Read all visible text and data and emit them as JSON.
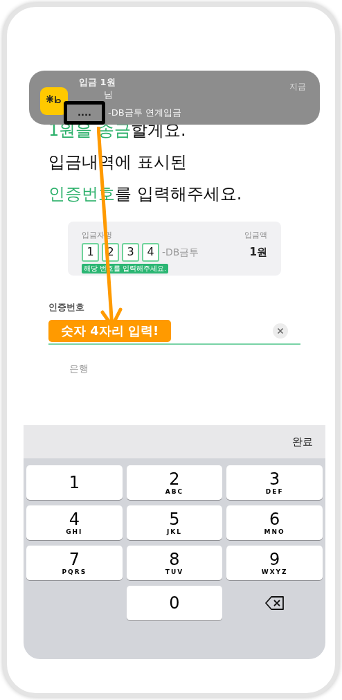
{
  "notification": {
    "title": "입금 1원",
    "sender": "님",
    "masked": "....",
    "detail": "-DB금투 연계입금",
    "time": "지금"
  },
  "heading": [
    [
      {
        "text": "1원을 송금",
        "highlight": true
      },
      {
        "text": "할게요.",
        "highlight": false
      }
    ],
    [
      {
        "text": "입금내역에 표시된",
        "highlight": false
      }
    ],
    [
      {
        "text": "인증번호",
        "highlight": true
      },
      {
        "text": "를 입력해주세요.",
        "highlight": false
      }
    ]
  ],
  "card": {
    "name_label": "입금자명",
    "amount_label": "입금액",
    "digits": [
      "1",
      "2",
      "3",
      "4"
    ],
    "suffix": "-DB금투",
    "amount": "1원",
    "hint": "해당 번호를 입력해주세요."
  },
  "field": {
    "label": "인증번호",
    "callout": "숫자 4자리 입력!"
  },
  "bank_label": "은행",
  "keyboard": {
    "done": "완료",
    "keys": [
      {
        "kind": "digit",
        "digit": "1"
      },
      {
        "kind": "digit",
        "digit": "2",
        "letters": "ABC"
      },
      {
        "kind": "digit",
        "digit": "3",
        "letters": "DEF"
      },
      {
        "kind": "digit",
        "digit": "4",
        "letters": "GHI"
      },
      {
        "kind": "digit",
        "digit": "5",
        "letters": "JKL"
      },
      {
        "kind": "digit",
        "digit": "6",
        "letters": "MNO"
      },
      {
        "kind": "digit",
        "digit": "7",
        "letters": "PQRS"
      },
      {
        "kind": "digit",
        "digit": "8",
        "letters": "TUV"
      },
      {
        "kind": "digit",
        "digit": "9",
        "letters": "WXYZ"
      },
      {
        "kind": "blank"
      },
      {
        "kind": "digit",
        "digit": "0"
      },
      {
        "kind": "delete"
      }
    ]
  }
}
